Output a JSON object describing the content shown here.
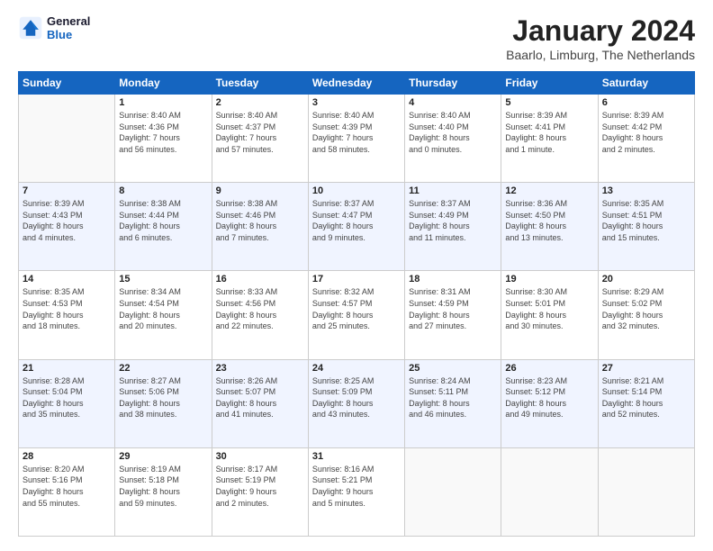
{
  "logo": {
    "line1": "General",
    "line2": "Blue"
  },
  "header": {
    "month": "January 2024",
    "location": "Baarlo, Limburg, The Netherlands"
  },
  "weekdays": [
    "Sunday",
    "Monday",
    "Tuesday",
    "Wednesday",
    "Thursday",
    "Friday",
    "Saturday"
  ],
  "weeks": [
    [
      {
        "day": "",
        "info": ""
      },
      {
        "day": "1",
        "info": "Sunrise: 8:40 AM\nSunset: 4:36 PM\nDaylight: 7 hours\nand 56 minutes."
      },
      {
        "day": "2",
        "info": "Sunrise: 8:40 AM\nSunset: 4:37 PM\nDaylight: 7 hours\nand 57 minutes."
      },
      {
        "day": "3",
        "info": "Sunrise: 8:40 AM\nSunset: 4:39 PM\nDaylight: 7 hours\nand 58 minutes."
      },
      {
        "day": "4",
        "info": "Sunrise: 8:40 AM\nSunset: 4:40 PM\nDaylight: 8 hours\nand 0 minutes."
      },
      {
        "day": "5",
        "info": "Sunrise: 8:39 AM\nSunset: 4:41 PM\nDaylight: 8 hours\nand 1 minute."
      },
      {
        "day": "6",
        "info": "Sunrise: 8:39 AM\nSunset: 4:42 PM\nDaylight: 8 hours\nand 2 minutes."
      }
    ],
    [
      {
        "day": "7",
        "info": "Sunrise: 8:39 AM\nSunset: 4:43 PM\nDaylight: 8 hours\nand 4 minutes."
      },
      {
        "day": "8",
        "info": "Sunrise: 8:38 AM\nSunset: 4:44 PM\nDaylight: 8 hours\nand 6 minutes."
      },
      {
        "day": "9",
        "info": "Sunrise: 8:38 AM\nSunset: 4:46 PM\nDaylight: 8 hours\nand 7 minutes."
      },
      {
        "day": "10",
        "info": "Sunrise: 8:37 AM\nSunset: 4:47 PM\nDaylight: 8 hours\nand 9 minutes."
      },
      {
        "day": "11",
        "info": "Sunrise: 8:37 AM\nSunset: 4:49 PM\nDaylight: 8 hours\nand 11 minutes."
      },
      {
        "day": "12",
        "info": "Sunrise: 8:36 AM\nSunset: 4:50 PM\nDaylight: 8 hours\nand 13 minutes."
      },
      {
        "day": "13",
        "info": "Sunrise: 8:35 AM\nSunset: 4:51 PM\nDaylight: 8 hours\nand 15 minutes."
      }
    ],
    [
      {
        "day": "14",
        "info": "Sunrise: 8:35 AM\nSunset: 4:53 PM\nDaylight: 8 hours\nand 18 minutes."
      },
      {
        "day": "15",
        "info": "Sunrise: 8:34 AM\nSunset: 4:54 PM\nDaylight: 8 hours\nand 20 minutes."
      },
      {
        "day": "16",
        "info": "Sunrise: 8:33 AM\nSunset: 4:56 PM\nDaylight: 8 hours\nand 22 minutes."
      },
      {
        "day": "17",
        "info": "Sunrise: 8:32 AM\nSunset: 4:57 PM\nDaylight: 8 hours\nand 25 minutes."
      },
      {
        "day": "18",
        "info": "Sunrise: 8:31 AM\nSunset: 4:59 PM\nDaylight: 8 hours\nand 27 minutes."
      },
      {
        "day": "19",
        "info": "Sunrise: 8:30 AM\nSunset: 5:01 PM\nDaylight: 8 hours\nand 30 minutes."
      },
      {
        "day": "20",
        "info": "Sunrise: 8:29 AM\nSunset: 5:02 PM\nDaylight: 8 hours\nand 32 minutes."
      }
    ],
    [
      {
        "day": "21",
        "info": "Sunrise: 8:28 AM\nSunset: 5:04 PM\nDaylight: 8 hours\nand 35 minutes."
      },
      {
        "day": "22",
        "info": "Sunrise: 8:27 AM\nSunset: 5:06 PM\nDaylight: 8 hours\nand 38 minutes."
      },
      {
        "day": "23",
        "info": "Sunrise: 8:26 AM\nSunset: 5:07 PM\nDaylight: 8 hours\nand 41 minutes."
      },
      {
        "day": "24",
        "info": "Sunrise: 8:25 AM\nSunset: 5:09 PM\nDaylight: 8 hours\nand 43 minutes."
      },
      {
        "day": "25",
        "info": "Sunrise: 8:24 AM\nSunset: 5:11 PM\nDaylight: 8 hours\nand 46 minutes."
      },
      {
        "day": "26",
        "info": "Sunrise: 8:23 AM\nSunset: 5:12 PM\nDaylight: 8 hours\nand 49 minutes."
      },
      {
        "day": "27",
        "info": "Sunrise: 8:21 AM\nSunset: 5:14 PM\nDaylight: 8 hours\nand 52 minutes."
      }
    ],
    [
      {
        "day": "28",
        "info": "Sunrise: 8:20 AM\nSunset: 5:16 PM\nDaylight: 8 hours\nand 55 minutes."
      },
      {
        "day": "29",
        "info": "Sunrise: 8:19 AM\nSunset: 5:18 PM\nDaylight: 8 hours\nand 59 minutes."
      },
      {
        "day": "30",
        "info": "Sunrise: 8:17 AM\nSunset: 5:19 PM\nDaylight: 9 hours\nand 2 minutes."
      },
      {
        "day": "31",
        "info": "Sunrise: 8:16 AM\nSunset: 5:21 PM\nDaylight: 9 hours\nand 5 minutes."
      },
      {
        "day": "",
        "info": ""
      },
      {
        "day": "",
        "info": ""
      },
      {
        "day": "",
        "info": ""
      }
    ]
  ]
}
